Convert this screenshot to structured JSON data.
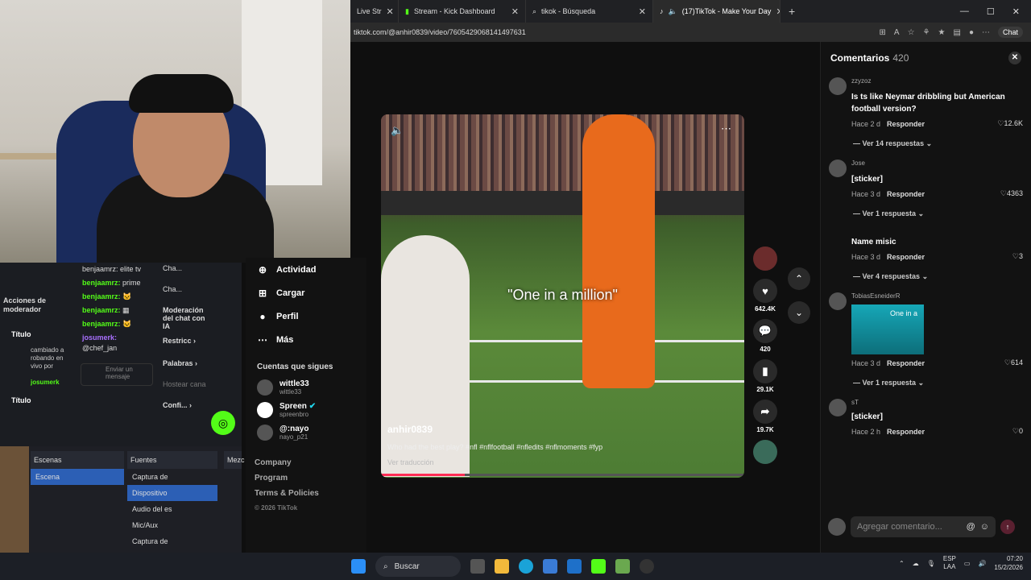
{
  "browser": {
    "tabs": [
      {
        "label": "Live Str",
        "icon": "kick-icon"
      },
      {
        "label": "Stream - Kick Dashboard",
        "icon": "kick-icon"
      },
      {
        "label": "tikok - Búsqueda",
        "icon": "search-icon"
      },
      {
        "label": "(17)TikTok - Make Your Day",
        "icon": "tiktok-icon"
      }
    ],
    "url": "tiktok.com/@anhir0839/video/7605429068141497631",
    "chat_label": "Chat"
  },
  "stream_panel": {
    "chat": [
      {
        "user": "benjaamrz:",
        "text": "prime"
      },
      {
        "user": "benjaamrz:",
        "text": ""
      },
      {
        "user": "benjaamrz:",
        "text": ""
      },
      {
        "user": "benjaamrz:",
        "text": ""
      }
    ],
    "chat_top_text": "benjaamrz: elite tv",
    "system_user": "josumerk:",
    "system_text": "@chef_jan",
    "send_placeholder": "Enviar un mensaje",
    "mod_actions": "Acciones de moderador",
    "title_label": "Título",
    "changed_text": "cambiado a robando en vivo por",
    "changed_by": "josumerk",
    "mod_options": [
      "Cha...",
      "Cha...",
      "Moderación del chat con IA",
      "Restricc",
      "Palabras",
      "Hostear cana",
      "Confi..."
    ]
  },
  "obs": {
    "scenes_title": "Escenas",
    "scenes": [
      "Escena"
    ],
    "sources_title": "Fuentes",
    "sources": [
      "Captura de",
      "Dispositivo",
      "Audio del es",
      "Mic/Aux",
      "Captura de"
    ],
    "mixer_title": "Mezc"
  },
  "tiktok_nav": {
    "items": [
      {
        "label": "Actividad",
        "icon": "activity-icon"
      },
      {
        "label": "Cargar",
        "icon": "upload-icon"
      },
      {
        "label": "Perfil",
        "icon": "profile-icon"
      },
      {
        "label": "Más",
        "icon": "more-icon"
      }
    ],
    "following_title": "Cuentas que sigues",
    "following": [
      {
        "name": "wittle33",
        "handle": "wittle33"
      },
      {
        "name": "Spreen",
        "handle": "spreenbro"
      },
      {
        "name": "@:nayo",
        "handle": "nayo_p21"
      }
    ],
    "footer": [
      "Company",
      "Program",
      "Terms & Policies",
      "© 2026 TikTok"
    ]
  },
  "video": {
    "overlay_text": "\"One in a million\"",
    "username": "anhir0839",
    "description": "Who had the best play? #nfl #nflfootball #nfledits #nflmoments #fyp",
    "translate": "Ver traducción",
    "progress": 0.23,
    "likes": "642.4K",
    "comments": "420",
    "saves": "29.1K",
    "shares": "19.7K"
  },
  "comments": {
    "title": "Comentarios",
    "count": "420",
    "items": [
      {
        "user": "zzyzoz",
        "text": "Is ts like Neymar dribbling but American football version?",
        "time": "Hace 2 d",
        "likes": "12.6K",
        "replies": "Ver 14 respuestas"
      },
      {
        "user": "Jose",
        "text": "[sticker]",
        "time": "Hace 3 d",
        "likes": "4363",
        "replies": "Ver 1 respuesta"
      },
      {
        "user": "",
        "text": "Name misic",
        "time": "Hace 3 d",
        "likes": "3",
        "replies": "Ver 4 respuestas"
      },
      {
        "user": "TobiasEsneiderR",
        "text": "",
        "time": "Hace 3 d",
        "likes": "614",
        "replies": "Ver 1 respuesta"
      },
      {
        "user": "sT",
        "text": "[sticker]",
        "time": "Hace 2 h",
        "likes": "0",
        "replies": ""
      }
    ],
    "reply_label": "Responder",
    "sticker_text": "One in a",
    "add_placeholder": "Agregar comentario..."
  },
  "taskbar": {
    "search": "Buscar",
    "lang": "ESP",
    "lang_sub": "LAA",
    "time": "07:20",
    "date": "15/2/2026"
  }
}
